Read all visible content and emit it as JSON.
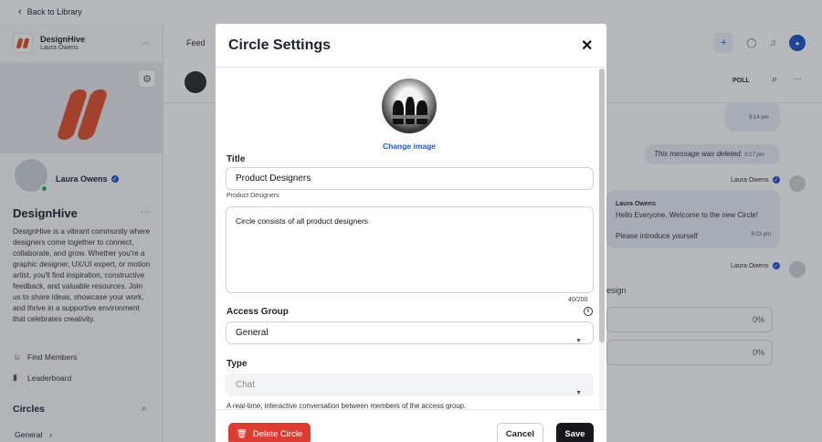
{
  "topbar": {
    "back_label": "Back to Library"
  },
  "sidebar": {
    "brand_name": "DesignHive",
    "brand_user": "Laura Owens",
    "member_name": "Laura Owens",
    "community_name": "DesignHive",
    "community_description": "DesignHive is a vibrant community where designers come together to connect, collaborate, and grow. Whether you're a graphic designer, UX/UI expert, or motion artist, you'll find inspiration, constructive feedback, and valuable resources. Join us to share ideas, showcase your work, and thrive in a supportive environment that celebrates creativity.",
    "links": [
      {
        "label": "Find Members",
        "icon": "people-icon"
      },
      {
        "label": "Leaderboard",
        "icon": "bar-chart-icon"
      }
    ],
    "circles_heading": "Circles",
    "circles": [
      {
        "label": "General"
      }
    ]
  },
  "main": {
    "nav_feed": "Feed",
    "poll_label": "POLL",
    "chat": {
      "wave_time": "9:14 pm",
      "deleted_text": "This message was deleted.",
      "deleted_time": "9:17 pm",
      "author1": "Laura Owens",
      "welcome_author": "Laura Owens",
      "welcome_text": "Hello Everyone, Welcome to the new Circle!",
      "intro_text": "Please introduce yourself",
      "intro_time": "9:23 pm",
      "author2": "Laura Owens",
      "poll_partial_title": "esign",
      "poll_options": [
        {
          "percent": "0%"
        },
        {
          "percent": "0%"
        }
      ]
    }
  },
  "modal": {
    "title": "Circle Settings",
    "change_image": "Change image",
    "title_label": "Title",
    "title_value": "Product Designers",
    "title_help": "Product Designers",
    "description_value": "Circle consists of all product designers",
    "char_counter": "40/200",
    "access_group_label": "Access Group",
    "access_group_value": "General",
    "type_label": "Type",
    "type_value": "Chat",
    "type_help": "A real-time, interactive conversation between members of the access group.",
    "delete_label": "Delete Circle",
    "cancel_label": "Cancel",
    "save_label": "Save"
  },
  "colors": {
    "accent": "#1f56c7",
    "danger": "#dc3d32",
    "brand": "#e0502c",
    "save_button": "#16181d"
  }
}
